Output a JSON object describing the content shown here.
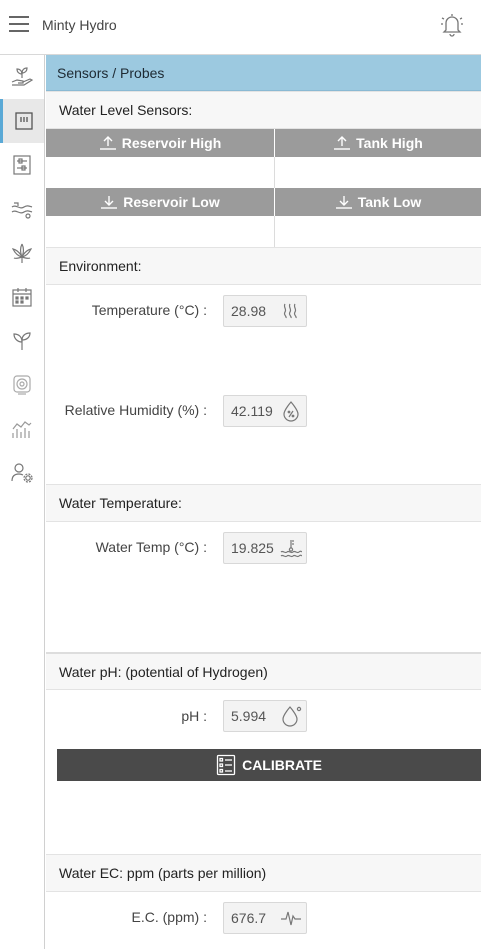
{
  "app": {
    "title": "Minty Hydro"
  },
  "icons": {
    "menu": "hamburger-menu-icon",
    "bell": "bell-icon",
    "sidebar": [
      "hand-sprout-icon",
      "sensor-probe-icon",
      "sliders-control-icon",
      "water-pump-icon",
      "cannabis-leaf-icon",
      "calendar-icon",
      "seedling-icon",
      "camera-icon",
      "chart-icon",
      "user-settings-icon"
    ]
  },
  "breadcrumb": "Sensors / Probes",
  "water_level": {
    "heading": "Water Level Sensors:",
    "reservoir_high": "Reservoir High",
    "tank_high": "Tank High",
    "reservoir_low": "Reservoir Low",
    "tank_low": "Tank Low"
  },
  "environment": {
    "heading": "Environment:",
    "temperature_label": "Temperature (°C) :",
    "temperature_value": "28.98",
    "humidity_label": "Relative Humidity (%) :",
    "humidity_value": "42.119"
  },
  "water_temperature": {
    "heading": "Water Temperature:",
    "label": "Water Temp (°C) :",
    "value": "19.825"
  },
  "ph": {
    "heading": "Water pH: (potential of Hydrogen)",
    "label": "pH :",
    "value": "5.994",
    "calibrate_label": "CALIBRATE"
  },
  "ec": {
    "heading": "Water EC: ppm (parts per million)",
    "label": "E.C. (ppm) :",
    "value": "676.7"
  },
  "colors": {
    "breadcrumb_bg": "#9cc9e0",
    "water_level_header_bg": "#9b9b9b",
    "calibrate_bg": "#4a4a4a",
    "active_sidebar_accent": "#5aa9d6"
  }
}
